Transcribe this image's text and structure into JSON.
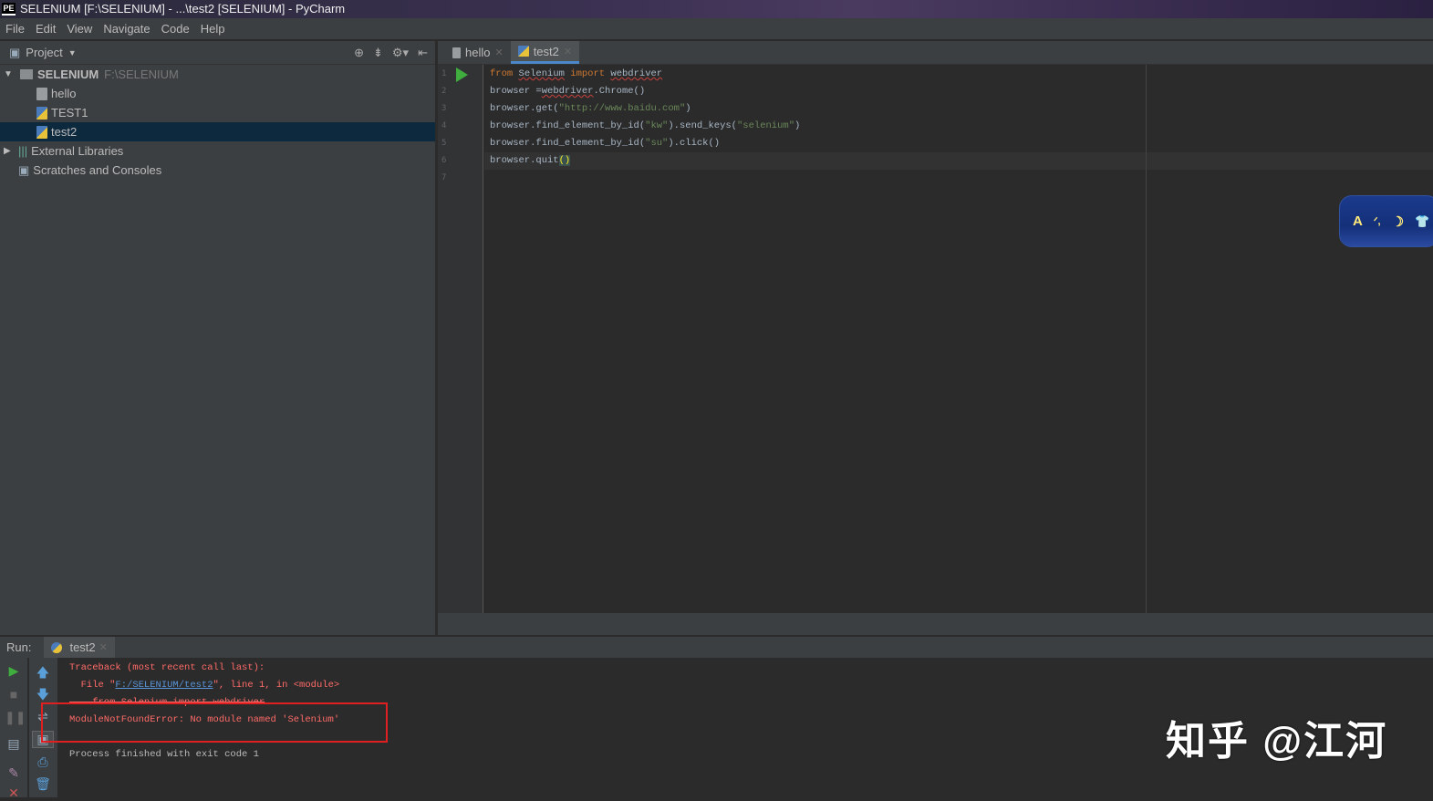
{
  "window": {
    "title": "SELENIUM [F:\\SELENIUM] - ...\\test2 [SELENIUM] - PyCharm",
    "app_icon": "PE"
  },
  "menu": [
    "File",
    "Edit",
    "View",
    "Navigate",
    "Code",
    "Help"
  ],
  "project": {
    "header": "Project",
    "root": {
      "name": "SELENIUM",
      "path": "F:\\SELENIUM"
    },
    "files": [
      {
        "name": "hello",
        "type": "plain"
      },
      {
        "name": "TEST1",
        "type": "python"
      },
      {
        "name": "test2",
        "type": "python",
        "selected": true
      }
    ],
    "external": "External Libraries",
    "scratches": "Scratches and Consoles"
  },
  "editor": {
    "tabs": [
      {
        "label": "hello",
        "active": false
      },
      {
        "label": "test2",
        "active": true
      }
    ],
    "line_numbers": [
      "1",
      "2",
      "3",
      "4",
      "5",
      "6",
      "7"
    ],
    "lines": [
      [
        {
          "t": "from",
          "c": "k"
        },
        {
          "t": " "
        },
        {
          "t": "Selenium",
          "c": "u"
        },
        {
          "t": " "
        },
        {
          "t": "import",
          "c": "k"
        },
        {
          "t": " "
        },
        {
          "t": "webdriver",
          "c": "u"
        }
      ],
      [
        {
          "t": "browser ="
        },
        {
          "t": "webdriver",
          "c": "u"
        },
        {
          "t": ".Chrome()"
        }
      ],
      [
        {
          "t": "browser.get("
        },
        {
          "t": "\"http://www.baidu.com\"",
          "c": "s"
        },
        {
          "t": ")"
        }
      ],
      [
        {
          "t": "browser.find_element_by_id("
        },
        {
          "t": "\"kw\"",
          "c": "s"
        },
        {
          "t": ").send_keys("
        },
        {
          "t": "\"selenium\"",
          "c": "s"
        },
        {
          "t": ")"
        }
      ],
      [
        {
          "t": "browser.find_element_by_id("
        },
        {
          "t": "\"su\"",
          "c": "s"
        },
        {
          "t": ").click()"
        }
      ],
      [
        {
          "t": "browser.quit"
        },
        {
          "t": "()",
          "c": "br"
        }
      ],
      []
    ]
  },
  "run": {
    "label": "Run:",
    "tab": "test2",
    "output": {
      "traceback": "Traceback (most recent call last):",
      "file_prefix": "  File \"",
      "file_link": "F:/SELENIUM/test2",
      "file_suffix": "\", line 1, in <module>",
      "source": "    from Selenium import webdriver",
      "error": "ModuleNotFoundError: No module named 'Selenium'",
      "finished": "Process finished with exit code 1"
    }
  },
  "widget": {
    "items": [
      "A",
      "ᐟ,",
      "☽",
      "👕"
    ]
  },
  "watermark": "知乎 @江河",
  "colors": {
    "error": "#ff6b68",
    "highlight_box": "#e02020",
    "selection": "#0d293e"
  }
}
